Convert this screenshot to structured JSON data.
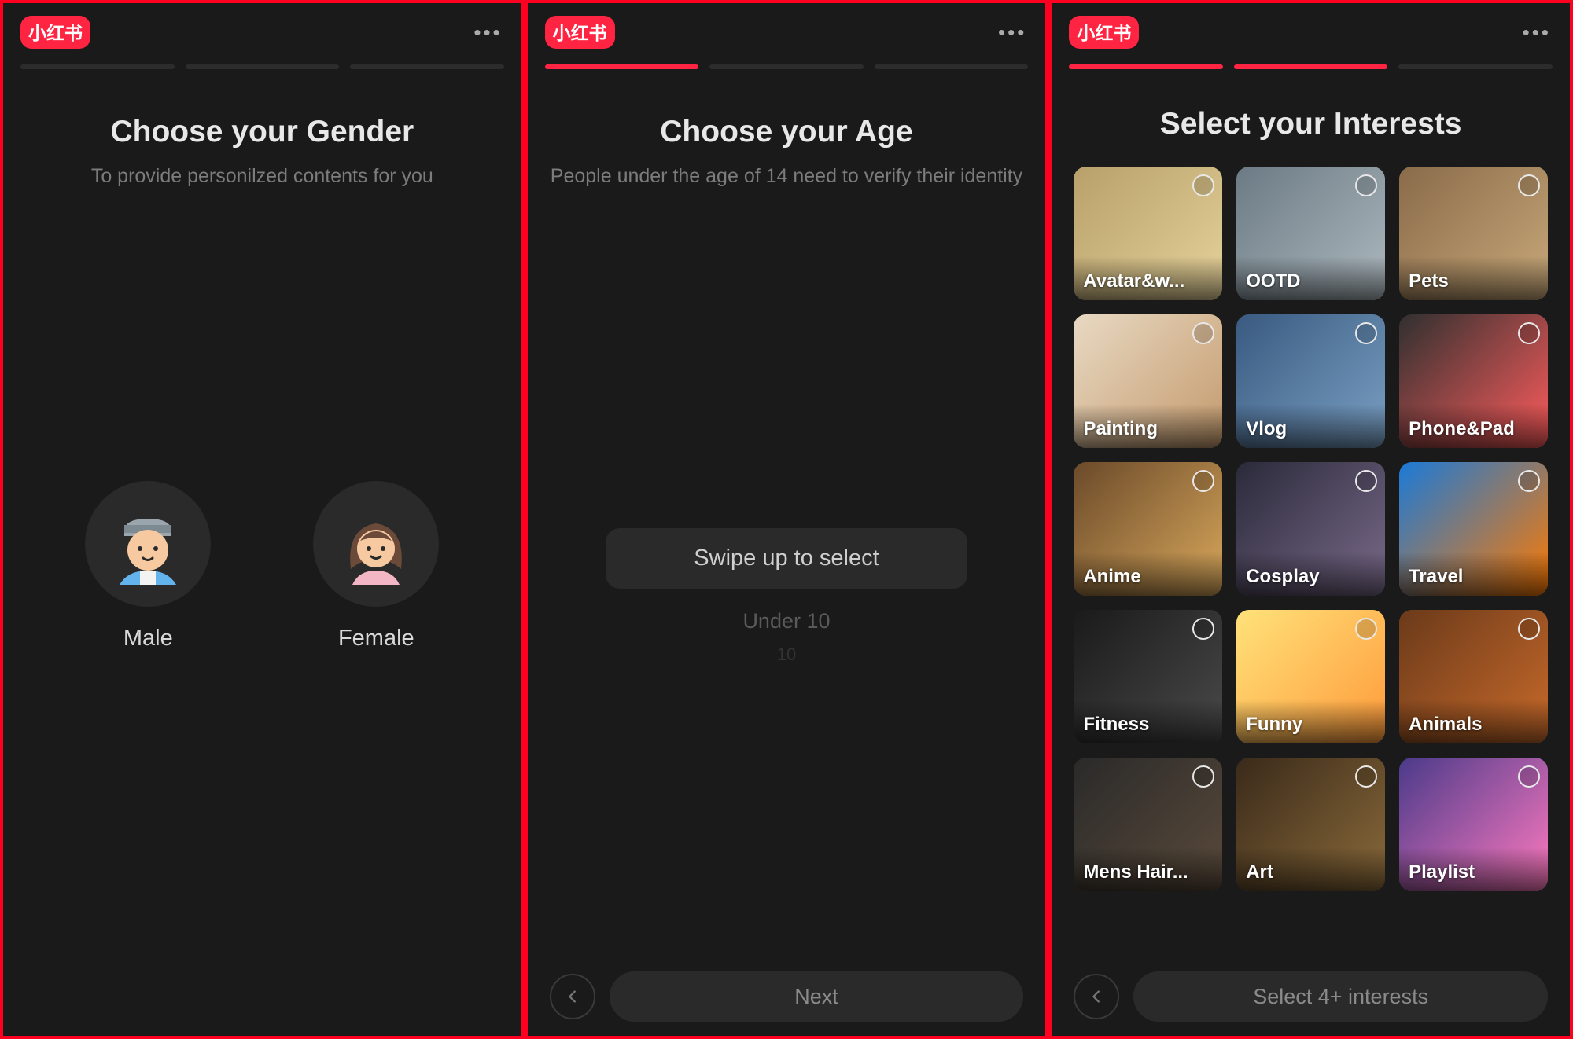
{
  "app": {
    "logo_text": "小红书"
  },
  "screen1": {
    "title": "Choose your Gender",
    "subtitle": "To provide personilzed contents for you",
    "options": [
      {
        "key": "male",
        "label": "Male"
      },
      {
        "key": "female",
        "label": "Female"
      }
    ],
    "progress_active": []
  },
  "screen2": {
    "title": "Choose your Age",
    "subtitle": "People under the age of 14 need to verify their identity",
    "picker_prompt": "Swipe up to select",
    "picker_next": "Under 10",
    "picker_next2": "10",
    "cta": "Next",
    "progress_active": [
      0
    ]
  },
  "screen3": {
    "title": "Select your Interests",
    "cta": "Select 4+ interests",
    "progress_active": [
      0,
      1
    ],
    "interests": [
      {
        "label": "Avatar&w...",
        "bg": "linear-gradient(135deg,#b8a06a,#e5d29a)"
      },
      {
        "label": "OOTD",
        "bg": "linear-gradient(135deg,#6b7a84,#aeb9bf)"
      },
      {
        "label": "Pets",
        "bg": "linear-gradient(135deg,#8a6b4a,#c8a879)"
      },
      {
        "label": "Painting",
        "bg": "linear-gradient(135deg,#e8d9c3,#c49a6c)"
      },
      {
        "label": "Vlog",
        "bg": "linear-gradient(135deg,#3a5a80,#7aa0c4)"
      },
      {
        "label": "Phone&Pad",
        "bg": "linear-gradient(135deg,#303030,#ff5c5c)"
      },
      {
        "label": "Anime",
        "bg": "linear-gradient(135deg,#6b4a2a,#d9a85c)"
      },
      {
        "label": "Cosplay",
        "bg": "linear-gradient(135deg,#2a2a3a,#7a6a8a)"
      },
      {
        "label": "Travel",
        "bg": "linear-gradient(135deg,#1a7ad9,#ff7a00)"
      },
      {
        "label": "Fitness",
        "bg": "linear-gradient(135deg,#1a1a1a,#4a4a4a)"
      },
      {
        "label": "Funny",
        "bg": "linear-gradient(135deg,#ffe27a,#ff9a3a)"
      },
      {
        "label": "Animals",
        "bg": "linear-gradient(135deg,#6b3a1a,#c86a2a)"
      },
      {
        "label": "Mens Hair...",
        "bg": "linear-gradient(135deg,#2a2a2a,#5a4a3a)"
      },
      {
        "label": "Art",
        "bg": "linear-gradient(135deg,#3a2a1a,#8a6a3a)"
      },
      {
        "label": "Playlist",
        "bg": "linear-gradient(135deg,#4a3a8a,#ff7abf)"
      }
    ],
    "partial_row": [
      {
        "bg": "linear-gradient(135deg,#c8b89a,#e8dcc0)"
      },
      {
        "bg": "linear-gradient(135deg,#ff2a5a,#8a1a3a)"
      },
      {
        "bg": "linear-gradient(135deg,#d9c8a8,#b89a6a)"
      }
    ]
  }
}
